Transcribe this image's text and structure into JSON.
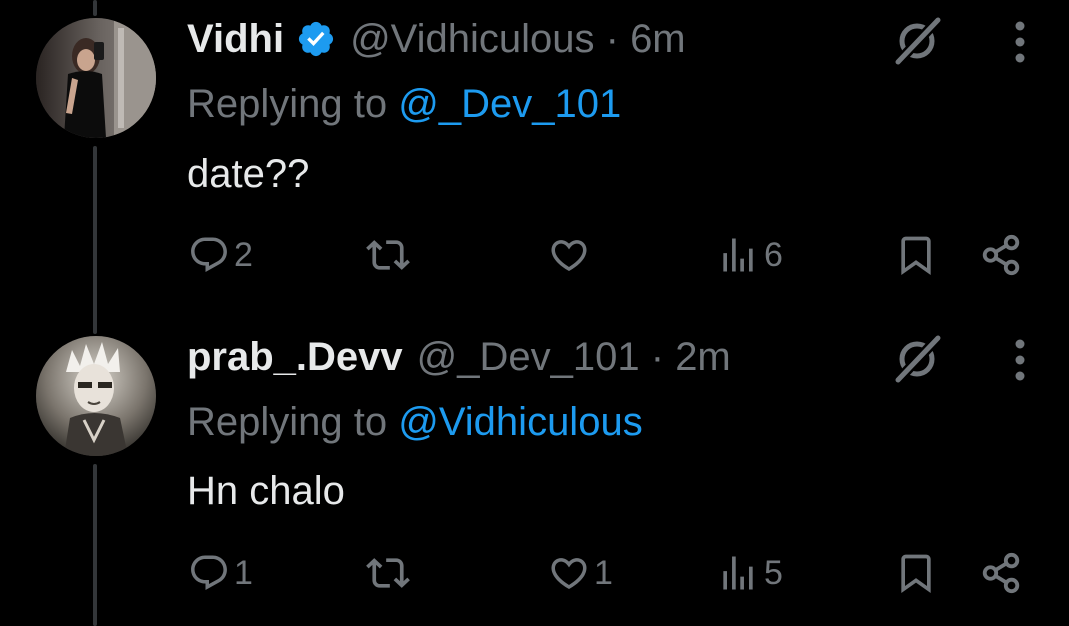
{
  "colors": {
    "background": "#000000",
    "primary_text": "#e7e9ea",
    "secondary_text": "#71767b",
    "link": "#1d9bf0",
    "verified": "#1d9bf0",
    "thread_line": "#333639"
  },
  "tweets": [
    {
      "display_name": "Vidhi",
      "verified": true,
      "handle_time": "@Vidhiculous · 6m",
      "replying_prefix": "Replying to ",
      "replying_to": "@_Dev_101",
      "text": "date??",
      "replies": "2",
      "reposts": "",
      "likes": "",
      "views": "6"
    },
    {
      "display_name": "prab_.Devv",
      "verified": false,
      "handle_time": "@_Dev_101 · 2m",
      "replying_prefix": "Replying to ",
      "replying_to": "@Vidhiculous",
      "text": "Hn chalo",
      "replies": "1",
      "reposts": "",
      "likes": "1",
      "views": "5"
    }
  ],
  "icons": {
    "reply": "reply-icon",
    "repost": "repost-icon",
    "like": "heart-icon",
    "views": "views-icon",
    "bookmark": "bookmark-icon",
    "share": "share-icon",
    "grok": "grok-icon",
    "more": "more-vertical-icon",
    "verified": "verified-badge-icon"
  }
}
